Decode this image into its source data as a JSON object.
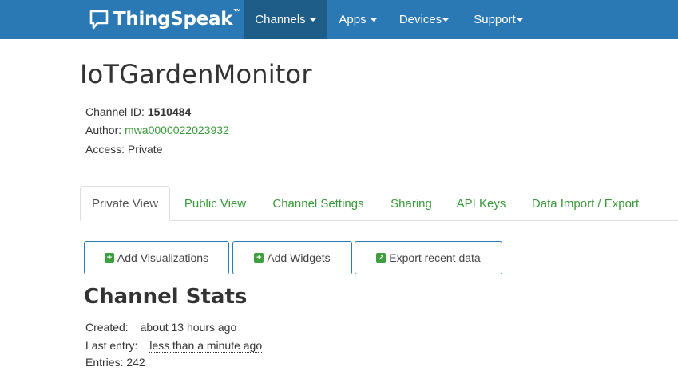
{
  "navbar": {
    "brand": "ThingSpeak",
    "brand_tm": "™",
    "items": [
      {
        "label": "Channels",
        "active": true
      },
      {
        "label": "Apps",
        "active": false
      },
      {
        "label": "Devices",
        "active": false
      },
      {
        "label": "Support",
        "active": false
      }
    ]
  },
  "channel": {
    "title": "IoTGardenMonitor",
    "id_label": "Channel ID: ",
    "id_value": "1510484",
    "author_label": "Author: ",
    "author_value": "mwa0000022023932",
    "access_label": "Access: ",
    "access_value": "Private"
  },
  "tabs": [
    {
      "label": "Private View",
      "active": true
    },
    {
      "label": "Public View",
      "active": false
    },
    {
      "label": "Channel Settings",
      "active": false
    },
    {
      "label": "Sharing",
      "active": false
    },
    {
      "label": "API Keys",
      "active": false
    },
    {
      "label": "Data Import / Export",
      "active": false
    }
  ],
  "buttons": {
    "add_visualizations": "Add Visualizations",
    "add_widgets": "Add Widgets",
    "export_recent": "Export recent data"
  },
  "stats": {
    "title": "Channel Stats",
    "created_label": "Created:",
    "created_value": "about 13 hours ago",
    "last_entry_label": "Last entry:",
    "last_entry_value": "less than a minute ago",
    "entries_label": "Entries: ",
    "entries_value": "242"
  },
  "colors": {
    "navbar": "#2b79b4",
    "navbar_active": "#1d5d87",
    "link": "#3a9a3a",
    "icon_green": "#3d9f3d"
  },
  "icons": {
    "brand": "speech-bubble-icon",
    "plus": "plus-square-icon",
    "external": "external-link-icon"
  }
}
